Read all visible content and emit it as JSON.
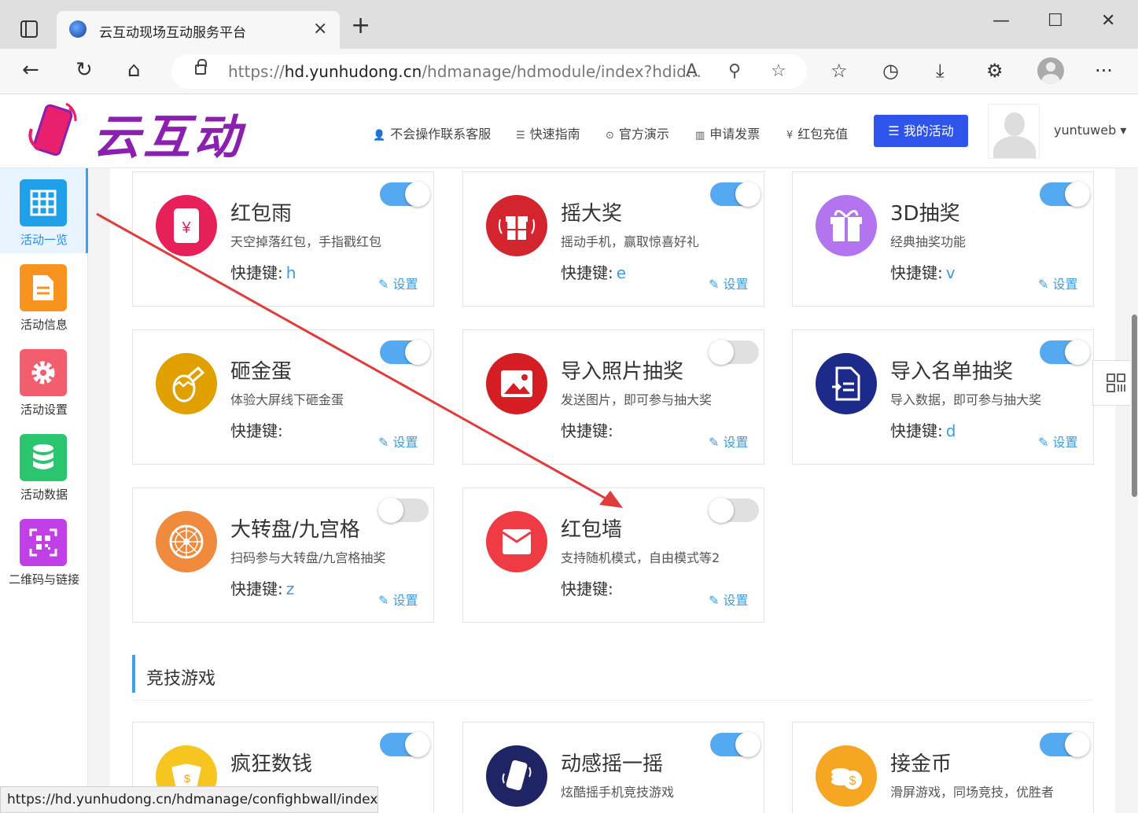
{
  "browser": {
    "tab_title": "云互动现场互动服务平台",
    "tab_close": "×",
    "new_tab": "+",
    "url_prefix": "https://",
    "url_host": "hd.yunhudong.cn",
    "url_path": "/hdmanage/hdmodule/index?hdid...",
    "status_url": "https://hd.yunhudong.cn/hdmanage/confighbwall/index..."
  },
  "header": {
    "logo_text": "云互动",
    "nav": [
      {
        "icon": "user-plus-icon",
        "label": "不会操作联系客服"
      },
      {
        "icon": "list-icon",
        "label": "快速指南"
      },
      {
        "icon": "play-icon",
        "label": "官方演示"
      },
      {
        "icon": "barcode-icon",
        "label": "申请发票"
      },
      {
        "icon": "yen-icon",
        "label": "红包充值"
      }
    ],
    "my_activity": "我的活动",
    "username": "yuntuweb"
  },
  "sidebar": {
    "items": [
      {
        "label": "活动一览",
        "icon": "grid-icon",
        "color": "#1fa0e8",
        "active": true
      },
      {
        "label": "活动信息",
        "icon": "document-icon",
        "color": "#f7931e",
        "active": false
      },
      {
        "label": "活动设置",
        "icon": "gear-icon",
        "color": "#f25e6e",
        "active": false
      },
      {
        "label": "活动数据",
        "icon": "database-icon",
        "color": "#2bc46f",
        "active": false
      },
      {
        "label": "二维码与链接",
        "icon": "qrcode-icon",
        "color": "#c03fe6",
        "active": false
      }
    ]
  },
  "common": {
    "hotkey_label": "快捷键:",
    "settings_label": "设置"
  },
  "modules": [
    {
      "title": "红包雨",
      "desc": "天空掉落红包，手指戳红包",
      "hotkey": "h",
      "enabled": true,
      "icon": "red-envelope-icon",
      "color": "#e8205a"
    },
    {
      "title": "摇大奖",
      "desc": "摇动手机，赢取惊喜好礼",
      "hotkey": "e",
      "enabled": true,
      "icon": "gift-shake-icon",
      "color": "#d3252e"
    },
    {
      "title": "3D抽奖",
      "desc": "经典抽奖功能",
      "hotkey": "v",
      "enabled": true,
      "icon": "gift-box-icon",
      "color": "#b374f0"
    },
    {
      "title": "砸金蛋",
      "desc": "体验大屏线下砸金蛋",
      "hotkey": "",
      "enabled": true,
      "icon": "golden-egg-icon",
      "color": "#dfa000"
    },
    {
      "title": "导入照片抽奖",
      "desc": "发送图片，即可参与抽大奖",
      "hotkey": "",
      "enabled": false,
      "icon": "photo-icon",
      "color": "#d51e24"
    },
    {
      "title": "导入名单抽奖",
      "desc": "导入数据，即可参与抽大奖",
      "hotkey": "d",
      "enabled": true,
      "icon": "import-list-icon",
      "color": "#1c2a8a"
    },
    {
      "title": "大转盘/九宫格",
      "desc": "扫码参与大转盘/九宫格抽奖",
      "hotkey": "z",
      "enabled": false,
      "icon": "wheel-icon",
      "color": "#f08a3c"
    },
    {
      "title": "红包墙",
      "desc": "支持随机模式，自由模式等2",
      "hotkey": "",
      "enabled": false,
      "icon": "envelope-wall-icon",
      "color": "#ee3b44"
    }
  ],
  "section": {
    "title": "竞技游戏"
  },
  "games": [
    {
      "title": "疯狂数钱",
      "desc": "",
      "enabled": true,
      "icon": "money-count-icon",
      "color": "#f7c520"
    },
    {
      "title": "动感摇一摇",
      "desc": "炫酷摇手机竞技游戏",
      "enabled": true,
      "icon": "phone-shake-icon",
      "color": "#1f2465"
    },
    {
      "title": "接金币",
      "desc": "滑屏游戏，同场竞技，优胜者",
      "enabled": true,
      "icon": "coins-icon",
      "color": "#f5a623"
    }
  ]
}
